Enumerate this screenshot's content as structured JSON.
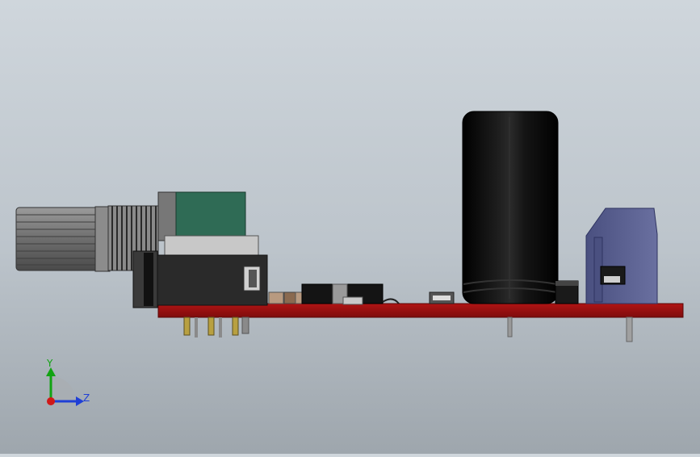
{
  "app": {
    "name": ""
  },
  "scene": {
    "view_orientation": "right",
    "background_color": "#c3cad1",
    "pcb_color": "#9a0f0f",
    "capacitor_color": "#0b0b0b",
    "potentiometer_color": "#2f6b55",
    "terminal_color": "#565d8e"
  },
  "triad": {
    "y_label": "Y",
    "z_label": "Z",
    "y_color": "#12a312",
    "z_color": "#1f3fd6",
    "x_color": "#d01818"
  }
}
